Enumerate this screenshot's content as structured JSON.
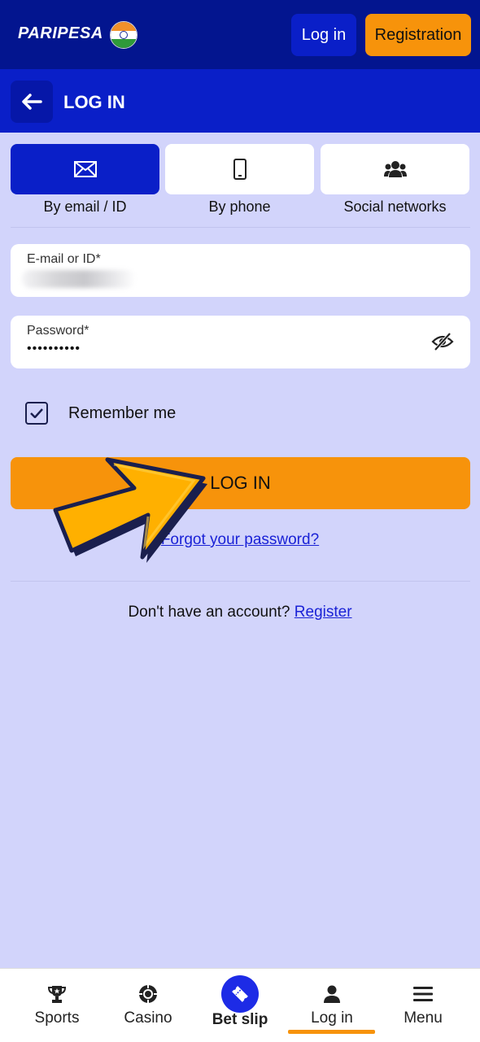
{
  "header": {
    "logo_text": "PARIPESA",
    "login_label": "Log in",
    "register_label": "Registration",
    "flag_icon": "india-flag-icon"
  },
  "login_bar": {
    "title": "LOG IN",
    "back_icon": "arrow-left-icon"
  },
  "method_tabs": [
    {
      "label": "By email / ID",
      "icon": "envelope-icon",
      "active": true
    },
    {
      "label": "By phone",
      "icon": "phone-icon",
      "active": false
    },
    {
      "label": "Social networks",
      "icon": "users-icon",
      "active": false
    }
  ],
  "form": {
    "email_label": "E-mail or ID*",
    "password_label": "Password*",
    "password_value": "••••••••••",
    "remember_label": "Remember me",
    "remember_checked": true,
    "submit_label": "LOG IN",
    "forgot_label": "Forgot your password?",
    "no_account_text": "Don't have an account?",
    "register_link": "Register"
  },
  "bottom_nav": [
    {
      "label": "Sports",
      "icon": "trophy-icon"
    },
    {
      "label": "Casino",
      "icon": "casino-chip-icon"
    },
    {
      "label": "Bet slip",
      "icon": "ticket-icon"
    },
    {
      "label": "Log in",
      "icon": "user-icon",
      "active": true
    },
    {
      "label": "Menu",
      "icon": "hamburger-menu-icon"
    }
  ],
  "colors": {
    "header_bg": "#03158f",
    "login_bar_bg": "#0a1fc8",
    "page_bg": "#d2d4fb",
    "accent_orange": "#f7930b",
    "link_blue": "#1a22d6"
  }
}
